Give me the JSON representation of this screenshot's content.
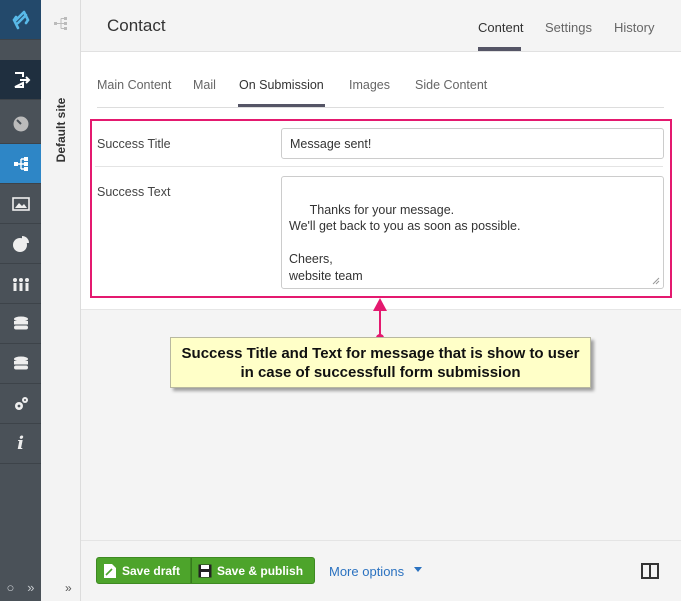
{
  "tree": {
    "site_label": "Default site",
    "expand_glyph": "»"
  },
  "rail": {
    "icons": [
      "logo-icon",
      "sign-out-icon",
      "dashboard-icon",
      "content-tree-icon",
      "media-icon",
      "analytics-icon",
      "members-icon",
      "database-icon",
      "database-alt-icon",
      "settings-icon",
      "info-icon"
    ],
    "bottom": [
      "○",
      "»"
    ]
  },
  "header": {
    "title": "Contact",
    "tabs": [
      {
        "label": "Content",
        "active": true
      },
      {
        "label": "Settings",
        "active": false
      },
      {
        "label": "History",
        "active": false
      }
    ]
  },
  "subtabs": [
    {
      "label": "Main Content",
      "active": false
    },
    {
      "label": "Mail",
      "active": false
    },
    {
      "label": "On Submission",
      "active": true
    },
    {
      "label": "Images",
      "active": false
    },
    {
      "label": "Side Content",
      "active": false
    }
  ],
  "form": {
    "success_title_label": "Success Title",
    "success_title_value": "Message sent!",
    "success_text_label": "Success Text",
    "success_text_value": "Thanks for your message.\nWe'll get back to you as soon as possible.\n\nCheers,\nwebsite team"
  },
  "callout": {
    "text": "Success Title and Text for message that is show to user in case of successfull form submission"
  },
  "footer": {
    "save_draft": "Save draft",
    "save_publish": "Save & publish",
    "more_options": "More options"
  },
  "colors": {
    "highlight": "#e4196f",
    "rail": "#4a5158",
    "rail_active": "#2e86c6",
    "button_green": "#4da42b",
    "link_blue": "#2b72c0",
    "callout_bg": "#ffffc8"
  }
}
